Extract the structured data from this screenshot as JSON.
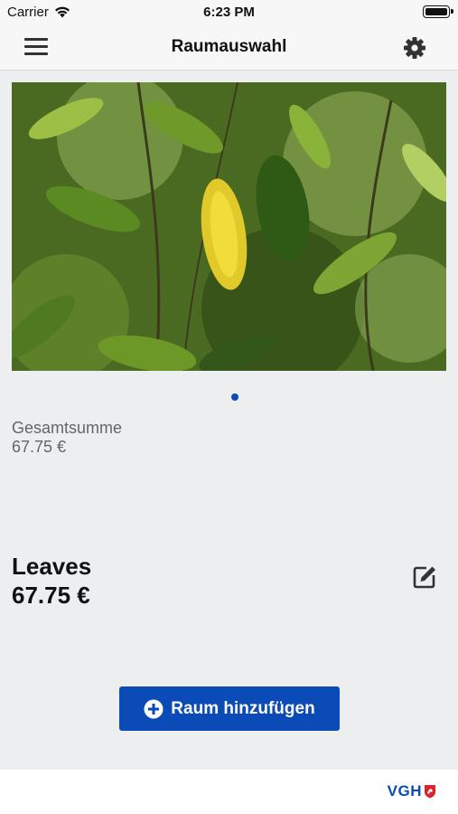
{
  "status_bar": {
    "carrier": "Carrier",
    "time": "6:23 PM"
  },
  "nav": {
    "title": "Raumauswahl",
    "menu_icon": "hamburger-menu-icon",
    "settings_icon": "gear-icon"
  },
  "carousel": {
    "page_count": 1,
    "current_page": 1
  },
  "summary": {
    "label": "Gesamtsumme",
    "value": "67.75 €"
  },
  "room": {
    "name": "Leaves",
    "value": "67.75 €",
    "edit_icon": "edit-icon"
  },
  "actions": {
    "add_room_label": "Raum hinzufügen"
  },
  "footer": {
    "logo": "VGH"
  },
  "colors": {
    "accent": "#0a4bb8",
    "background": "#eceeef",
    "logo_red": "#d9232d"
  }
}
